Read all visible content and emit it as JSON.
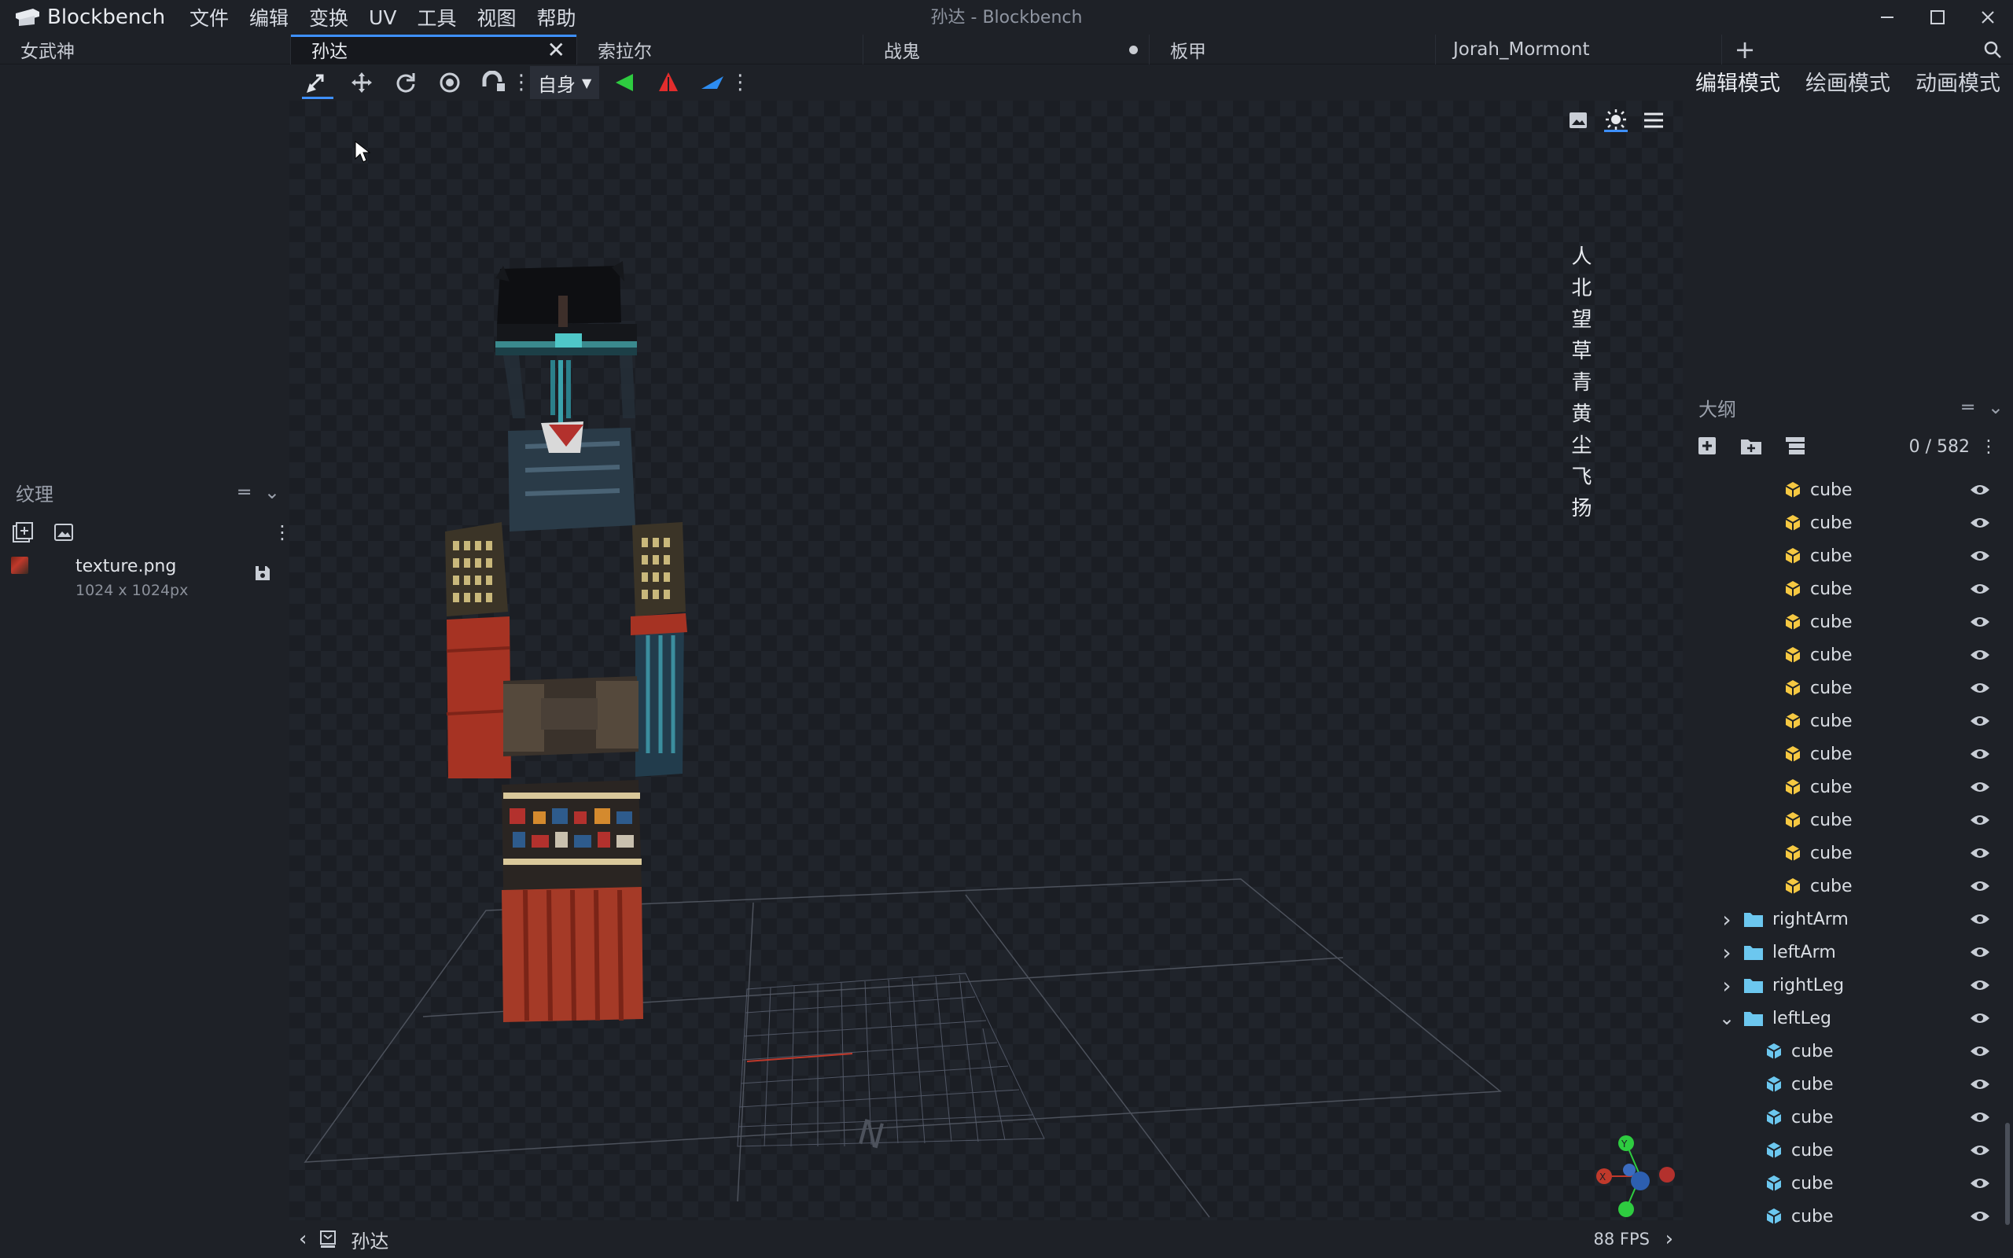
{
  "app": {
    "name": "Blockbench",
    "window_title": "孙达 - Blockbench"
  },
  "menu": [
    "文件",
    "编辑",
    "变换",
    "UV",
    "工具",
    "视图",
    "帮助"
  ],
  "tabs": [
    {
      "label": "女武神",
      "state": "normal"
    },
    {
      "label": "孙达",
      "state": "active"
    },
    {
      "label": "索拉尔",
      "state": "normal"
    },
    {
      "label": "战鬼",
      "state": "unsaved"
    },
    {
      "label": "板甲",
      "state": "normal"
    },
    {
      "label": "Jorah_Mormont",
      "state": "normal"
    }
  ],
  "toolbar": {
    "space_dropdown": "自身"
  },
  "modes": [
    "编辑模式",
    "绘画模式",
    "动画模式"
  ],
  "textures_panel": {
    "title": "纹理",
    "items": [
      {
        "name": "texture.png",
        "size": "1024 x 1024px"
      }
    ]
  },
  "viewport": {
    "vertical_text": "人北望草青黄尘飞扬"
  },
  "outliner": {
    "title": "大纲",
    "count": "0 / 582",
    "rows": [
      {
        "type": "cube",
        "name": "cube",
        "level": 2,
        "color": "#f5c842"
      },
      {
        "type": "cube",
        "name": "cube",
        "level": 2,
        "color": "#f5c842"
      },
      {
        "type": "cube",
        "name": "cube",
        "level": 2,
        "color": "#f5c842"
      },
      {
        "type": "cube",
        "name": "cube",
        "level": 2,
        "color": "#f5c842"
      },
      {
        "type": "cube",
        "name": "cube",
        "level": 2,
        "color": "#f5c842"
      },
      {
        "type": "cube",
        "name": "cube",
        "level": 2,
        "color": "#f5c842"
      },
      {
        "type": "cube",
        "name": "cube",
        "level": 2,
        "color": "#f5c842"
      },
      {
        "type": "cube",
        "name": "cube",
        "level": 2,
        "color": "#f5c842"
      },
      {
        "type": "cube",
        "name": "cube",
        "level": 2,
        "color": "#f5c842"
      },
      {
        "type": "cube",
        "name": "cube",
        "level": 2,
        "color": "#f5c842"
      },
      {
        "type": "cube",
        "name": "cube",
        "level": 2,
        "color": "#f5c842"
      },
      {
        "type": "cube",
        "name": "cube",
        "level": 2,
        "color": "#f5c842"
      },
      {
        "type": "cube",
        "name": "cube",
        "level": 2,
        "color": "#f5c842"
      },
      {
        "type": "group",
        "name": "rightArm",
        "expanded": false,
        "level": 1
      },
      {
        "type": "group",
        "name": "leftArm",
        "expanded": false,
        "level": 1
      },
      {
        "type": "group",
        "name": "rightLeg",
        "expanded": false,
        "level": 1
      },
      {
        "type": "group",
        "name": "leftLeg",
        "expanded": true,
        "level": 1
      },
      {
        "type": "cube",
        "name": "cube",
        "level": 2,
        "color": "#6cc7ef"
      },
      {
        "type": "cube",
        "name": "cube",
        "level": 2,
        "color": "#6cc7ef"
      },
      {
        "type": "cube",
        "name": "cube",
        "level": 2,
        "color": "#6cc7ef"
      },
      {
        "type": "cube",
        "name": "cube",
        "level": 2,
        "color": "#6cc7ef"
      },
      {
        "type": "cube",
        "name": "cube",
        "level": 2,
        "color": "#6cc7ef"
      },
      {
        "type": "cube",
        "name": "cube",
        "level": 2,
        "color": "#6cc7ef"
      }
    ]
  },
  "status": {
    "model_name": "孙达",
    "fps": "88 FPS"
  },
  "colors": {
    "accent": "#3e90ff",
    "panel_bg": "#1e2127",
    "viewport_bg": "#1b1e24"
  }
}
